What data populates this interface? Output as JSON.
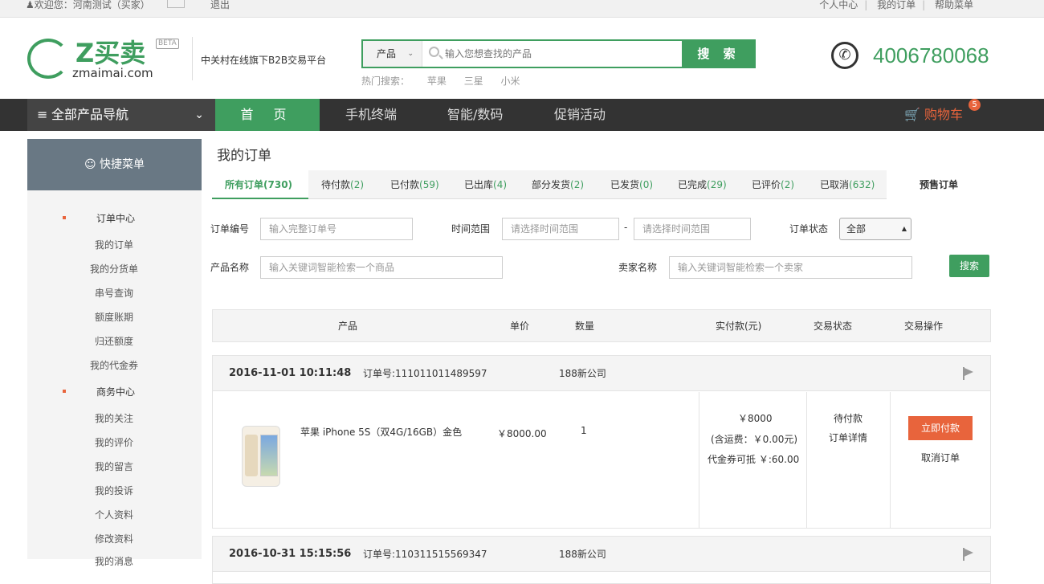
{
  "topbar": {
    "welcome": "欢迎您：河南测试（买家）",
    "logout": "退出",
    "links": [
      "个人中心",
      "我的订单",
      "帮助菜单"
    ]
  },
  "logo": {
    "brand": "Z买卖",
    "beta": "BETA",
    "domain": "zmaimai.com"
  },
  "slogan": "中关村在线旗下B2B交易平台",
  "search": {
    "category": "产品",
    "placeholder": "输入您想查找的产品",
    "button": "搜 索"
  },
  "hot": {
    "label": "热门搜索：",
    "items": [
      "苹果",
      "三星",
      "小米"
    ]
  },
  "hotline": "4006780068",
  "nav": {
    "all_categories": "全部产品导航",
    "items": [
      "首 页",
      "手机终端",
      "智能/数码",
      "促销活动"
    ],
    "cart": "购物车",
    "cart_count": "5"
  },
  "sidebar": {
    "title": "快捷菜单",
    "group1": "订单中心",
    "group1_items": [
      "我的订单",
      "我的分货单",
      "串号查询",
      "额度账期",
      "归还额度",
      "我的代金券"
    ],
    "group2": "商务中心",
    "group2_items": [
      "我的关注",
      "我的评价",
      "我的留言",
      "我的投诉",
      "个人资料",
      "修改资料",
      "我的消息"
    ]
  },
  "page_title": "我的订单",
  "tabs": [
    {
      "label": "所有订单",
      "count": "(730)"
    },
    {
      "label": "待付款",
      "count": "(2)"
    },
    {
      "label": "已付款",
      "count": "(59)"
    },
    {
      "label": "已出库",
      "count": "(4)"
    },
    {
      "label": "部分发货",
      "count": "(2)"
    },
    {
      "label": "已发货",
      "count": "(0)"
    },
    {
      "label": "已完成",
      "count": "(29)"
    },
    {
      "label": "已评价",
      "count": "(2)"
    },
    {
      "label": "已取消",
      "count": "(632)"
    },
    {
      "label": "预售订单",
      "count": ""
    }
  ],
  "filters": {
    "order_no_label": "订单编号",
    "order_no_placeholder": "输入完整订单号",
    "time_label": "时间范围",
    "time_placeholder": "请选择时间范围",
    "time_sep": "-",
    "status_label": "订单状态",
    "status_value": "全部",
    "product_label": "产品名称",
    "product_placeholder": "输入关键词智能检索一个商品",
    "seller_label": "卖家名称",
    "seller_placeholder": "输入关键词智能检索一个卖家",
    "search_button": "搜索"
  },
  "table_headers": [
    "产品",
    "单价",
    "数量",
    "实付款(元)",
    "交易状态",
    "交易操作"
  ],
  "orders": [
    {
      "time": "2016-11-01 10:11:48",
      "order_no": "订单号:111011011489597",
      "seller": "188新公司",
      "product": "苹果 iPhone 5S（双4G/16GB）金色",
      "price": "￥8000.00",
      "qty": "1",
      "paid": "￥8000",
      "shipping": "(含运费：￥0.00元)",
      "voucher": "代金券可抵 ￥:60.00",
      "status": "待付款",
      "detail": "订单详情",
      "pay_button": "立即付款",
      "cancel": "取消订单"
    },
    {
      "time": "2016-10-31 15:15:56",
      "order_no": "订单号:110311515569347",
      "seller": "188新公司"
    }
  ]
}
